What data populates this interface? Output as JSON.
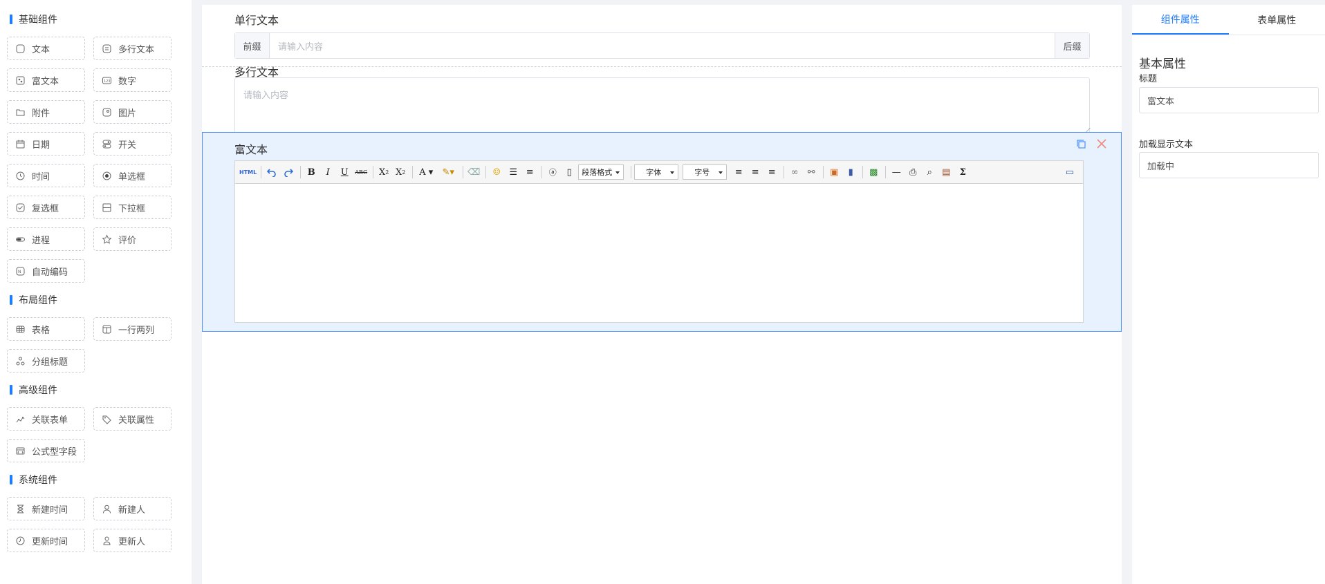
{
  "palette": {
    "groups": [
      {
        "title": "基础组件",
        "items": [
          {
            "label": "文本",
            "icon": "text-icon"
          },
          {
            "label": "多行文本",
            "icon": "multiline-text-icon"
          },
          {
            "label": "富文本",
            "icon": "rich-text-icon"
          },
          {
            "label": "数字",
            "icon": "number-icon"
          },
          {
            "label": "附件",
            "icon": "folder-icon"
          },
          {
            "label": "图片",
            "icon": "image-icon"
          },
          {
            "label": "日期",
            "icon": "calendar-icon"
          },
          {
            "label": "开关",
            "icon": "switch-icon"
          },
          {
            "label": "时间",
            "icon": "clock-icon"
          },
          {
            "label": "单选框",
            "icon": "radio-icon"
          },
          {
            "label": "复选框",
            "icon": "checkbox-icon"
          },
          {
            "label": "下拉框",
            "icon": "select-icon"
          },
          {
            "label": "进程",
            "icon": "progress-icon"
          },
          {
            "label": "评价",
            "icon": "star-icon"
          },
          {
            "label": "自动编码",
            "icon": "auto-code-icon"
          }
        ]
      },
      {
        "title": "布局组件",
        "items": [
          {
            "label": "表格",
            "icon": "table-icon"
          },
          {
            "label": "一行两列",
            "icon": "two-column-icon"
          },
          {
            "label": "分组标题",
            "icon": "group-title-icon"
          }
        ]
      },
      {
        "title": "高级组件",
        "items": [
          {
            "label": "关联表单",
            "icon": "link-form-icon"
          },
          {
            "label": "关联属性",
            "icon": "tag-icon"
          },
          {
            "label": "公式型字段",
            "icon": "formula-icon"
          }
        ]
      },
      {
        "title": "系统组件",
        "items": [
          {
            "label": "新建时间",
            "icon": "hourglass-icon"
          },
          {
            "label": "新建人",
            "icon": "user-icon"
          },
          {
            "label": "更新时间",
            "icon": "update-time-icon"
          },
          {
            "label": "更新人",
            "icon": "user-update-icon"
          }
        ]
      }
    ]
  },
  "canvas": {
    "single_text": {
      "label": "单行文本",
      "prefix": "前缀",
      "suffix": "后缀",
      "placeholder": "请输入内容"
    },
    "multi_text": {
      "label": "多行文本",
      "placeholder": "请输入内容"
    },
    "rich_text": {
      "label": "富文本",
      "toolbar": {
        "html": "HTML",
        "paragraph": "段落格式",
        "font": "字体",
        "size": "字号"
      }
    }
  },
  "props": {
    "tabs": [
      "组件属性",
      "表单属性"
    ],
    "active_tab": 0,
    "section_title": "基本属性",
    "title_label": "标题",
    "title_value": "富文本",
    "loading_label": "加载显示文本",
    "loading_value": "加载中"
  },
  "colors": {
    "accent": "#1f7cff",
    "selected_bg": "#e8f1fe"
  }
}
